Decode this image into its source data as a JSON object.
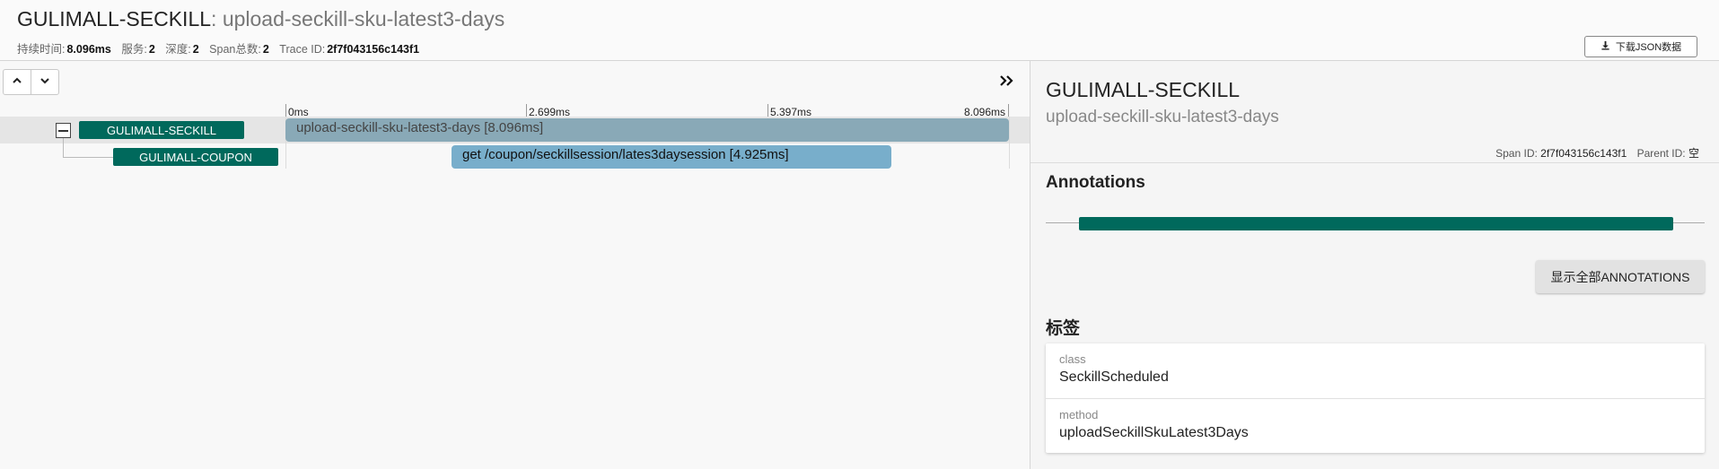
{
  "header": {
    "service": "GULIMALL-SECKILL",
    "separator": ": ",
    "operation": "upload-seckill-sku-latest3-days",
    "stats": {
      "duration_label": "持续时间:",
      "duration": "8.096ms",
      "services_label": "服务:",
      "services": "2",
      "depth_label": "深度:",
      "depth": "2",
      "span_total_label": "Span总数:",
      "span_total": "2",
      "trace_id_label": "Trace ID:",
      "trace_id": "2f7f043156c143f1"
    },
    "download_label": "下载JSON数据"
  },
  "timeline": {
    "ticks": [
      "0ms",
      "2.699ms",
      "5.397ms",
      "8.096ms"
    ],
    "spans": [
      {
        "service": "GULIMALL-SECKILL",
        "label": "upload-seckill-sku-latest3-days [8.096ms]"
      },
      {
        "service": "GULIMALL-COUPON",
        "label": "get /coupon/seckillsession/lates3daysession [4.925ms]"
      }
    ]
  },
  "detail": {
    "service": "GULIMALL-SECKILL",
    "operation": "upload-seckill-sku-latest3-days",
    "span_id_label": "Span ID:",
    "span_id": "2f7f043156c143f1",
    "parent_id_label": "Parent ID:",
    "parent_id": "空",
    "annotations_title": "Annotations",
    "show_all_label": "显示全部ANNOTATIONS",
    "tags_title": "标签",
    "tags": [
      {
        "key": "class",
        "value": "SeckillScheduled"
      },
      {
        "key": "method",
        "value": "uploadSeckillSkuLatest3Days"
      }
    ]
  },
  "colors": {
    "service_badge": "#00695c",
    "root_bar": "#89a9b7",
    "child_bar": "#78aecb",
    "annotation_bar": "#00695c"
  }
}
